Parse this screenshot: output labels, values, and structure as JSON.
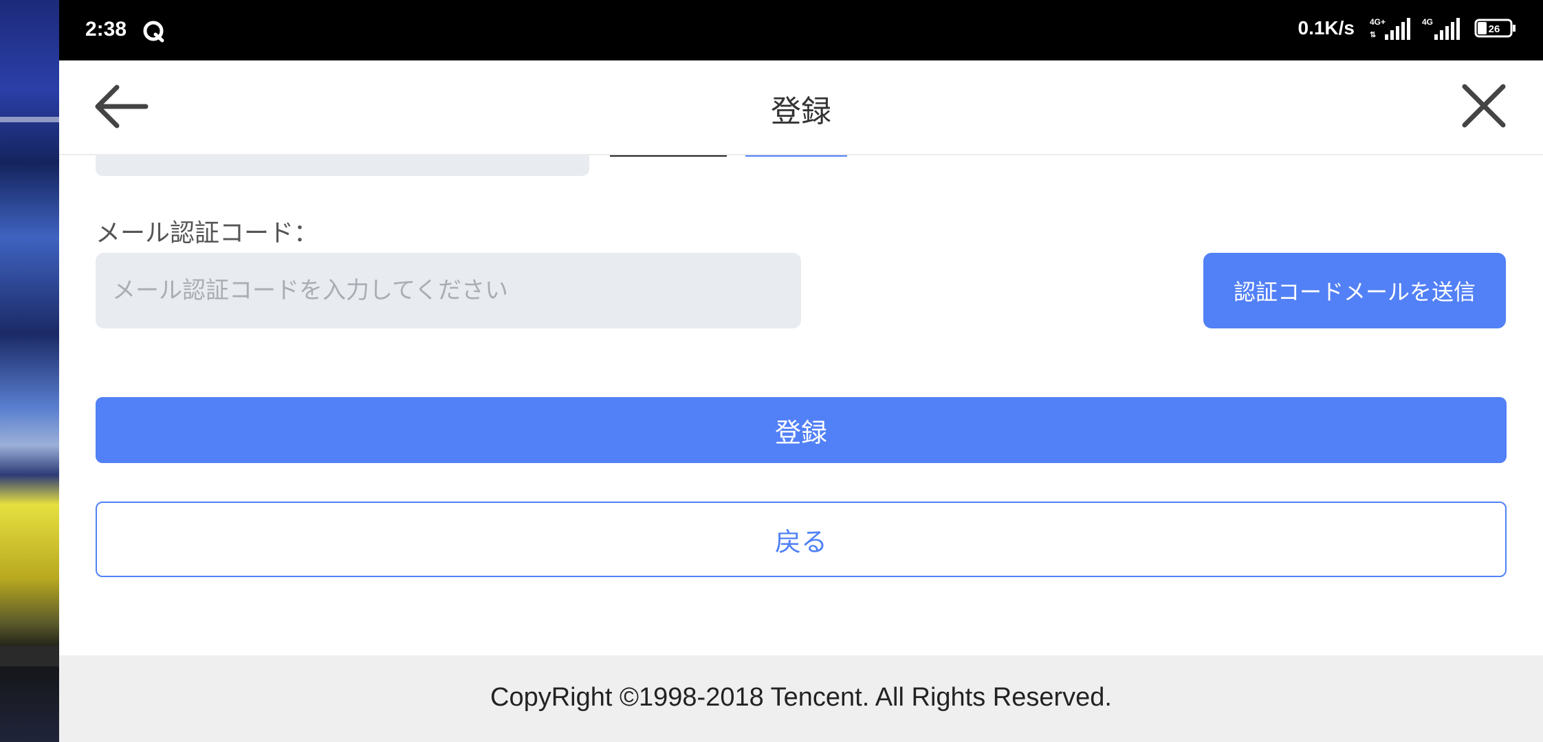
{
  "status_bar": {
    "time": "2:38",
    "app_icon": "qq-browser-icon",
    "net_speed": "0.1K/s",
    "network_1": "4G+",
    "network_2": "4G",
    "battery": "26"
  },
  "header": {
    "title": "登録",
    "back_icon": "arrow-left-icon",
    "close_icon": "close-icon"
  },
  "form": {
    "email_code_label": "メール認証コード：",
    "email_code_input": {
      "value": "",
      "placeholder": "メール認証コードを入力してください"
    },
    "send_code_button": "認証コードメールを送信",
    "register_button": "登録",
    "back_button": "戻る"
  },
  "footer": {
    "copyright": "CopyRight ©1998-2018 Tencent. All Rights Reserved."
  },
  "colors": {
    "primary": "#5280f6",
    "input_bg": "#e8ebef",
    "footer_bg": "#f0eff0"
  }
}
